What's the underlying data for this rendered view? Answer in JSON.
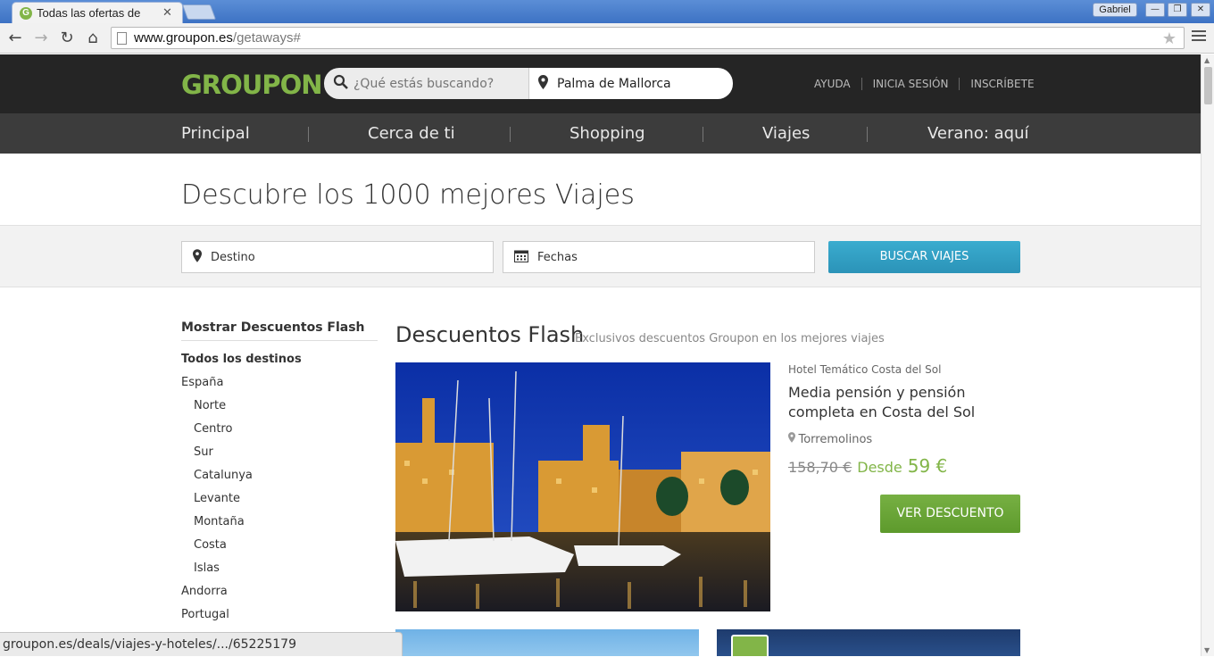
{
  "browser": {
    "tab_title": "Todas las ofertas de",
    "tab_favicon_letter": "G",
    "tab_close": "✕",
    "user_name": "Gabriel",
    "url_host": "www.groupon.es",
    "url_path": "/getaways#",
    "status_url": "groupon.es/deals/viajes-y-hoteles/.../65225179"
  },
  "header": {
    "logo": "GROUPON",
    "search_placeholder": "¿Qué estás buscando?",
    "location_value": "Palma de Mallorca",
    "links": [
      "AYUDA",
      "INICIA SESIÓN",
      "INSCRÍBETE"
    ]
  },
  "catnav": {
    "items": [
      "Principal",
      "Cerca de ti",
      "Shopping",
      "Viajes",
      "Verano: aquí"
    ]
  },
  "hero": {
    "title": "Descubre los 1000 mejores Viajes"
  },
  "trip_search": {
    "destination_placeholder": "Destino",
    "dates_placeholder": "Fechas",
    "button_label": "BUSCAR VIAJES"
  },
  "sidebar": {
    "title": "Mostrar Descuentos Flash",
    "items": [
      {
        "label": "Todos los destinos",
        "level": "bold"
      },
      {
        "label": "España",
        "level": "top"
      },
      {
        "label": "Norte",
        "level": "sub"
      },
      {
        "label": "Centro",
        "level": "sub"
      },
      {
        "label": "Sur",
        "level": "sub"
      },
      {
        "label": "Catalunya",
        "level": "sub"
      },
      {
        "label": "Levante",
        "level": "sub"
      },
      {
        "label": "Montaña",
        "level": "sub"
      },
      {
        "label": "Costa",
        "level": "sub"
      },
      {
        "label": "Islas",
        "level": "sub"
      },
      {
        "label": "Andorra",
        "level": "top"
      },
      {
        "label": "Portugal",
        "level": "top"
      }
    ]
  },
  "section": {
    "title": "Descuentos Flash",
    "subtitle": "Exclusivos descuentos Groupon en los mejores viajes"
  },
  "deal": {
    "vendor": "Hotel Temático Costa del Sol",
    "title": "Media pensión y pensión completa en Costa del Sol",
    "location": "Torremolinos",
    "old_price": "158,70 €",
    "from_label": "Desde",
    "new_price": "59 €",
    "button_label": "VER DESCUENTO"
  },
  "colors": {
    "brand_green": "#82b548",
    "header_dark": "#252525",
    "nav_gray": "#3c3c3c",
    "search_blue": "#2b93b8"
  }
}
